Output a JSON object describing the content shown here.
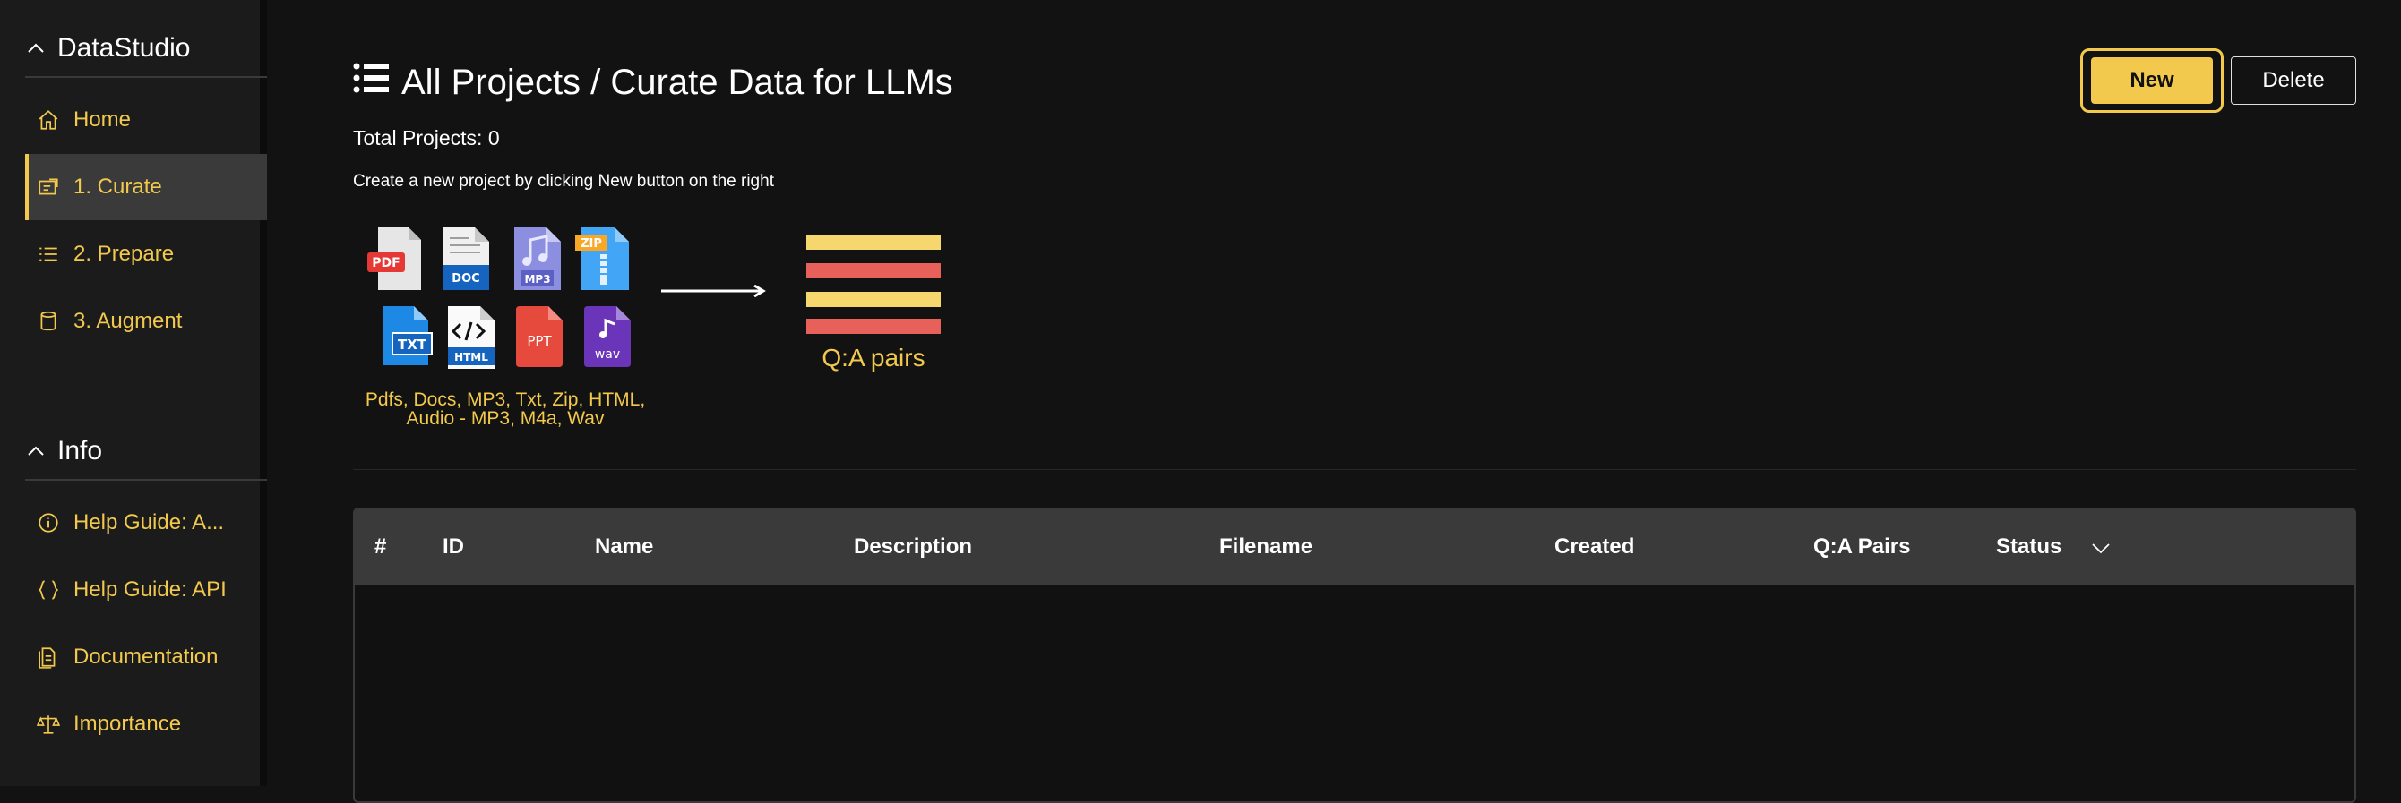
{
  "sidebar": {
    "app_section": "DataStudio",
    "nav": [
      {
        "label": "Home",
        "icon": "home-icon"
      },
      {
        "label": "1. Curate",
        "icon": "curate-icon",
        "active": true
      },
      {
        "label": "2. Prepare",
        "icon": "list-icon"
      },
      {
        "label": "3. Augment",
        "icon": "database-icon"
      }
    ],
    "info_section": "Info",
    "info": [
      {
        "label": "Help Guide: A...",
        "icon": "info-icon"
      },
      {
        "label": "Help Guide: API",
        "icon": "braces-icon"
      },
      {
        "label": "Documentation",
        "icon": "document-icon"
      },
      {
        "label": "Importance",
        "icon": "scale-icon"
      }
    ]
  },
  "main": {
    "title": "All Projects / Curate Data for LLMs",
    "total": "Total Projects: 0",
    "hint": "Create a new project by clicking New button on the right",
    "new_label": "New",
    "delete_label": "Delete"
  },
  "illustration": {
    "file_types": [
      "PDF",
      "DOC",
      "MP3",
      "ZIP",
      "TXT",
      "HTML",
      "PPT",
      "wav"
    ],
    "formats_line1": "Pdfs, Docs, MP3, Txt, Zip, HTML,",
    "formats_line2": "Audio - MP3, M4a, Wav",
    "qa_label": "Q:A pairs",
    "colors": {
      "yellow": "#f5d76e",
      "red": "#e8605a",
      "accent": "#f2c94c"
    }
  },
  "table": {
    "columns": [
      "#",
      "ID",
      "Name",
      "Description",
      "Filename",
      "Created",
      "Q:A Pairs",
      "Status"
    ],
    "rows": []
  }
}
